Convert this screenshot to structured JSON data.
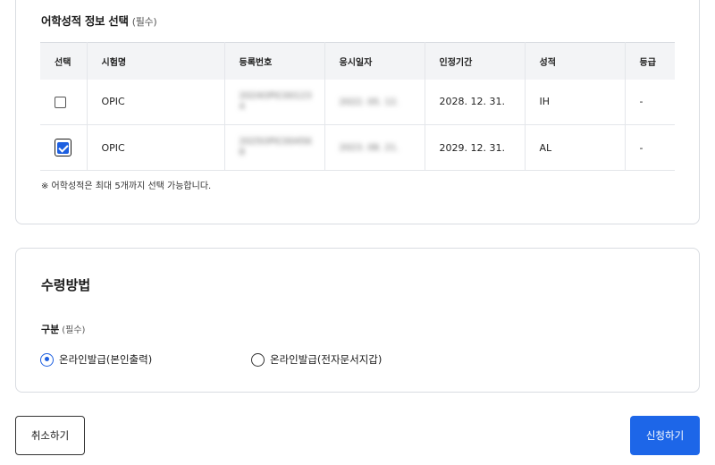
{
  "scores_section": {
    "title": "어학성적 정보 선택",
    "required": "(필수)",
    "columns": [
      "선택",
      "시험명",
      "등록번호",
      "응시일자",
      "인정기간",
      "성적",
      "등급"
    ],
    "rows": [
      {
        "checked": false,
        "exam": "OPIC",
        "reg_no": "2024OPIC00123\n4",
        "test_date": "2022. 05. 12.",
        "valid_until": "2028. 12. 31.",
        "score": "IH",
        "grade": "-"
      },
      {
        "checked": true,
        "exam": "OPIC",
        "reg_no": "2025OPIC00456\n8",
        "test_date": "2023. 08. 21.",
        "valid_until": "2029. 12. 31.",
        "score": "AL",
        "grade": "-"
      }
    ],
    "note": "※ 어학성적은 최대 5개까지 선택 가능합니다."
  },
  "method_section": {
    "title": "수령방법",
    "sub_label": "구분",
    "required": "(필수)",
    "options": [
      {
        "label": "온라인발급(본인출력)",
        "selected": true
      },
      {
        "label": "온라인발급(전자문서지갑)",
        "selected": false
      }
    ]
  },
  "buttons": {
    "cancel": "취소하기",
    "apply": "신청하기"
  },
  "colors": {
    "accent": "#1d66e8",
    "border": "#d9dce1",
    "header_bg": "#f3f4f6"
  }
}
